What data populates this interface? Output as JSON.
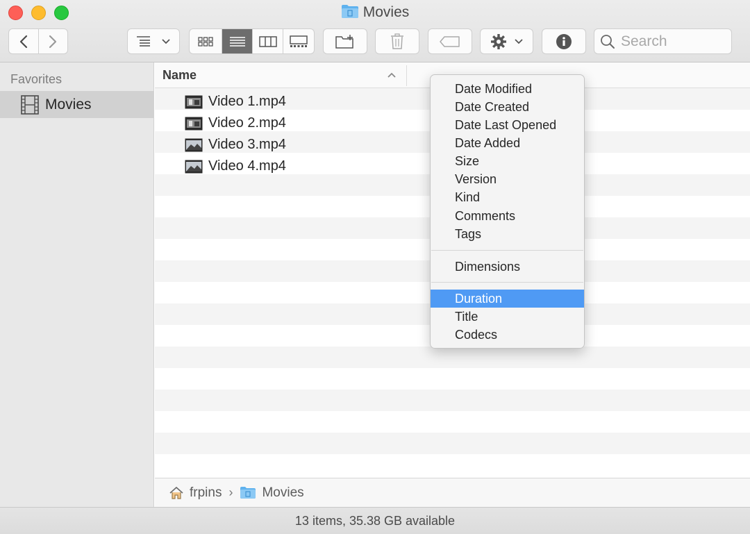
{
  "window": {
    "title": "Movies"
  },
  "toolbar": {
    "back_icon": "chevron-left-icon",
    "forward_icon": "chevron-right-icon",
    "group_icon": "list-group-icon",
    "view_modes": [
      "icon-view",
      "list-view",
      "column-view",
      "gallery-view"
    ],
    "active_view": "list-view",
    "new_folder_icon": "new-folder-icon",
    "trash_icon": "trash-icon",
    "tag_icon": "tag-icon",
    "action_icon": "gear-icon",
    "info_icon": "info-icon",
    "search_placeholder": "Search"
  },
  "sidebar": {
    "section_title": "Favorites",
    "items": [
      {
        "label": "Movies",
        "icon": "film-icon",
        "selected": true
      }
    ]
  },
  "list": {
    "column_name": "Name",
    "files": [
      {
        "name": "Video 1.mp4"
      },
      {
        "name": "Video 2.mp4"
      },
      {
        "name": "Video 3.mp4"
      },
      {
        "name": "Video 4.mp4"
      }
    ]
  },
  "context_menu": {
    "group1": [
      "Date Modified",
      "Date Created",
      "Date Last Opened",
      "Date Added",
      "Size",
      "Version",
      "Kind",
      "Comments",
      "Tags"
    ],
    "group2": [
      "Dimensions"
    ],
    "group3": [
      "Duration",
      "Title",
      "Codecs"
    ],
    "highlighted": "Duration"
  },
  "pathbar": {
    "items": [
      "frpins",
      "Movies"
    ]
  },
  "status": {
    "text": "13 items, 35.38 GB available"
  },
  "colors": {
    "highlight": "#4f9af4",
    "folder": "#5fb2ee",
    "close": "#fe5f57",
    "minimize": "#febc2e",
    "zoom": "#28c840"
  }
}
